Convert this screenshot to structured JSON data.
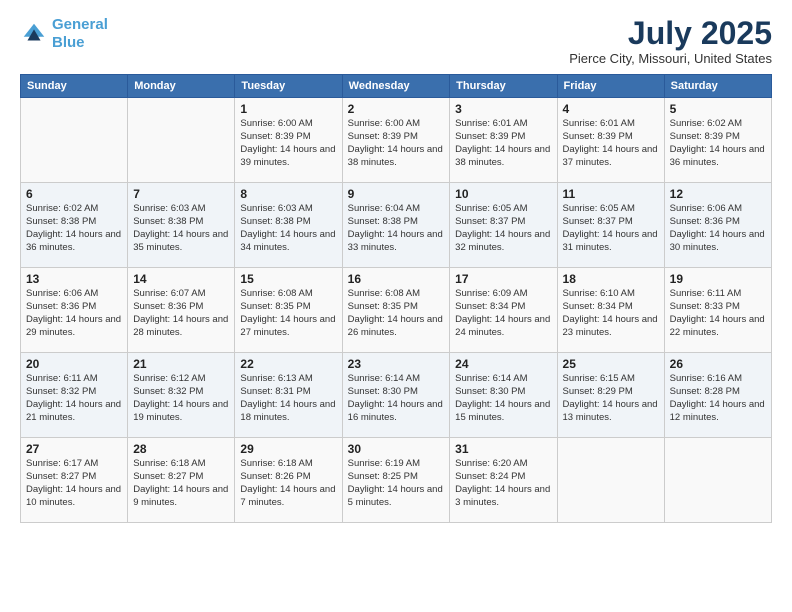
{
  "header": {
    "logo_line1": "General",
    "logo_line2": "Blue",
    "main_title": "July 2025",
    "subtitle": "Pierce City, Missouri, United States"
  },
  "weekdays": [
    "Sunday",
    "Monday",
    "Tuesday",
    "Wednesday",
    "Thursday",
    "Friday",
    "Saturday"
  ],
  "weeks": [
    [
      {
        "day": "",
        "detail": ""
      },
      {
        "day": "",
        "detail": ""
      },
      {
        "day": "1",
        "detail": "Sunrise: 6:00 AM\nSunset: 8:39 PM\nDaylight: 14 hours and 39 minutes."
      },
      {
        "day": "2",
        "detail": "Sunrise: 6:00 AM\nSunset: 8:39 PM\nDaylight: 14 hours and 38 minutes."
      },
      {
        "day": "3",
        "detail": "Sunrise: 6:01 AM\nSunset: 8:39 PM\nDaylight: 14 hours and 38 minutes."
      },
      {
        "day": "4",
        "detail": "Sunrise: 6:01 AM\nSunset: 8:39 PM\nDaylight: 14 hours and 37 minutes."
      },
      {
        "day": "5",
        "detail": "Sunrise: 6:02 AM\nSunset: 8:39 PM\nDaylight: 14 hours and 36 minutes."
      }
    ],
    [
      {
        "day": "6",
        "detail": "Sunrise: 6:02 AM\nSunset: 8:38 PM\nDaylight: 14 hours and 36 minutes."
      },
      {
        "day": "7",
        "detail": "Sunrise: 6:03 AM\nSunset: 8:38 PM\nDaylight: 14 hours and 35 minutes."
      },
      {
        "day": "8",
        "detail": "Sunrise: 6:03 AM\nSunset: 8:38 PM\nDaylight: 14 hours and 34 minutes."
      },
      {
        "day": "9",
        "detail": "Sunrise: 6:04 AM\nSunset: 8:38 PM\nDaylight: 14 hours and 33 minutes."
      },
      {
        "day": "10",
        "detail": "Sunrise: 6:05 AM\nSunset: 8:37 PM\nDaylight: 14 hours and 32 minutes."
      },
      {
        "day": "11",
        "detail": "Sunrise: 6:05 AM\nSunset: 8:37 PM\nDaylight: 14 hours and 31 minutes."
      },
      {
        "day": "12",
        "detail": "Sunrise: 6:06 AM\nSunset: 8:36 PM\nDaylight: 14 hours and 30 minutes."
      }
    ],
    [
      {
        "day": "13",
        "detail": "Sunrise: 6:06 AM\nSunset: 8:36 PM\nDaylight: 14 hours and 29 minutes."
      },
      {
        "day": "14",
        "detail": "Sunrise: 6:07 AM\nSunset: 8:36 PM\nDaylight: 14 hours and 28 minutes."
      },
      {
        "day": "15",
        "detail": "Sunrise: 6:08 AM\nSunset: 8:35 PM\nDaylight: 14 hours and 27 minutes."
      },
      {
        "day": "16",
        "detail": "Sunrise: 6:08 AM\nSunset: 8:35 PM\nDaylight: 14 hours and 26 minutes."
      },
      {
        "day": "17",
        "detail": "Sunrise: 6:09 AM\nSunset: 8:34 PM\nDaylight: 14 hours and 24 minutes."
      },
      {
        "day": "18",
        "detail": "Sunrise: 6:10 AM\nSunset: 8:34 PM\nDaylight: 14 hours and 23 minutes."
      },
      {
        "day": "19",
        "detail": "Sunrise: 6:11 AM\nSunset: 8:33 PM\nDaylight: 14 hours and 22 minutes."
      }
    ],
    [
      {
        "day": "20",
        "detail": "Sunrise: 6:11 AM\nSunset: 8:32 PM\nDaylight: 14 hours and 21 minutes."
      },
      {
        "day": "21",
        "detail": "Sunrise: 6:12 AM\nSunset: 8:32 PM\nDaylight: 14 hours and 19 minutes."
      },
      {
        "day": "22",
        "detail": "Sunrise: 6:13 AM\nSunset: 8:31 PM\nDaylight: 14 hours and 18 minutes."
      },
      {
        "day": "23",
        "detail": "Sunrise: 6:14 AM\nSunset: 8:30 PM\nDaylight: 14 hours and 16 minutes."
      },
      {
        "day": "24",
        "detail": "Sunrise: 6:14 AM\nSunset: 8:30 PM\nDaylight: 14 hours and 15 minutes."
      },
      {
        "day": "25",
        "detail": "Sunrise: 6:15 AM\nSunset: 8:29 PM\nDaylight: 14 hours and 13 minutes."
      },
      {
        "day": "26",
        "detail": "Sunrise: 6:16 AM\nSunset: 8:28 PM\nDaylight: 14 hours and 12 minutes."
      }
    ],
    [
      {
        "day": "27",
        "detail": "Sunrise: 6:17 AM\nSunset: 8:27 PM\nDaylight: 14 hours and 10 minutes."
      },
      {
        "day": "28",
        "detail": "Sunrise: 6:18 AM\nSunset: 8:27 PM\nDaylight: 14 hours and 9 minutes."
      },
      {
        "day": "29",
        "detail": "Sunrise: 6:18 AM\nSunset: 8:26 PM\nDaylight: 14 hours and 7 minutes."
      },
      {
        "day": "30",
        "detail": "Sunrise: 6:19 AM\nSunset: 8:25 PM\nDaylight: 14 hours and 5 minutes."
      },
      {
        "day": "31",
        "detail": "Sunrise: 6:20 AM\nSunset: 8:24 PM\nDaylight: 14 hours and 3 minutes."
      },
      {
        "day": "",
        "detail": ""
      },
      {
        "day": "",
        "detail": ""
      }
    ]
  ]
}
